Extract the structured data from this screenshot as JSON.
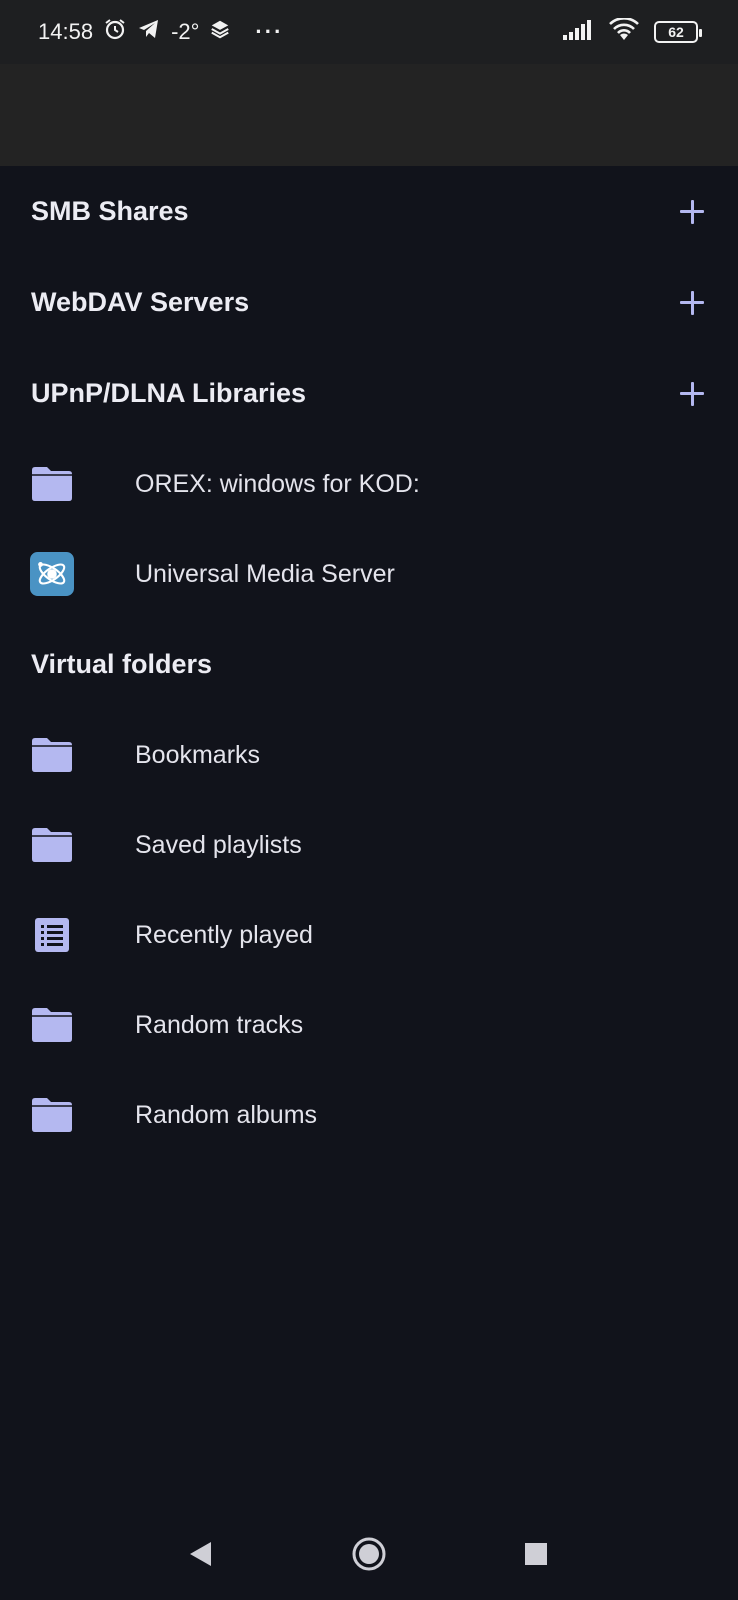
{
  "status_bar": {
    "time": "14:58",
    "temperature": "-2°",
    "battery": "62",
    "more": "···"
  },
  "sections": [
    {
      "title": "SMB Shares",
      "add_icon": "plus-icon",
      "items": []
    },
    {
      "title": "WebDAV Servers",
      "add_icon": "plus-icon",
      "items": []
    },
    {
      "title": "UPnP/DLNA Libraries",
      "add_icon": "plus-icon",
      "items": [
        {
          "label": "OREX: windows for KOD:",
          "icon": "folder-icon"
        },
        {
          "label": "Universal Media Server",
          "icon": "ums-server-icon"
        }
      ]
    },
    {
      "title": "Virtual folders",
      "items": [
        {
          "label": "Bookmarks",
          "icon": "folder-icon"
        },
        {
          "label": "Saved playlists",
          "icon": "folder-icon"
        },
        {
          "label": "Recently played",
          "icon": "list-icon"
        },
        {
          "label": "Random tracks",
          "icon": "folder-icon"
        },
        {
          "label": "Random albums",
          "icon": "folder-icon"
        }
      ]
    }
  ],
  "colors": {
    "background": "#11131b",
    "accent": "#b4b8f0",
    "status_bar": "#1e1f21",
    "app_bar": "#232323"
  },
  "nav_bar": {
    "back_icon": "back-icon",
    "home_icon": "home-icon",
    "recents_icon": "recents-icon"
  }
}
